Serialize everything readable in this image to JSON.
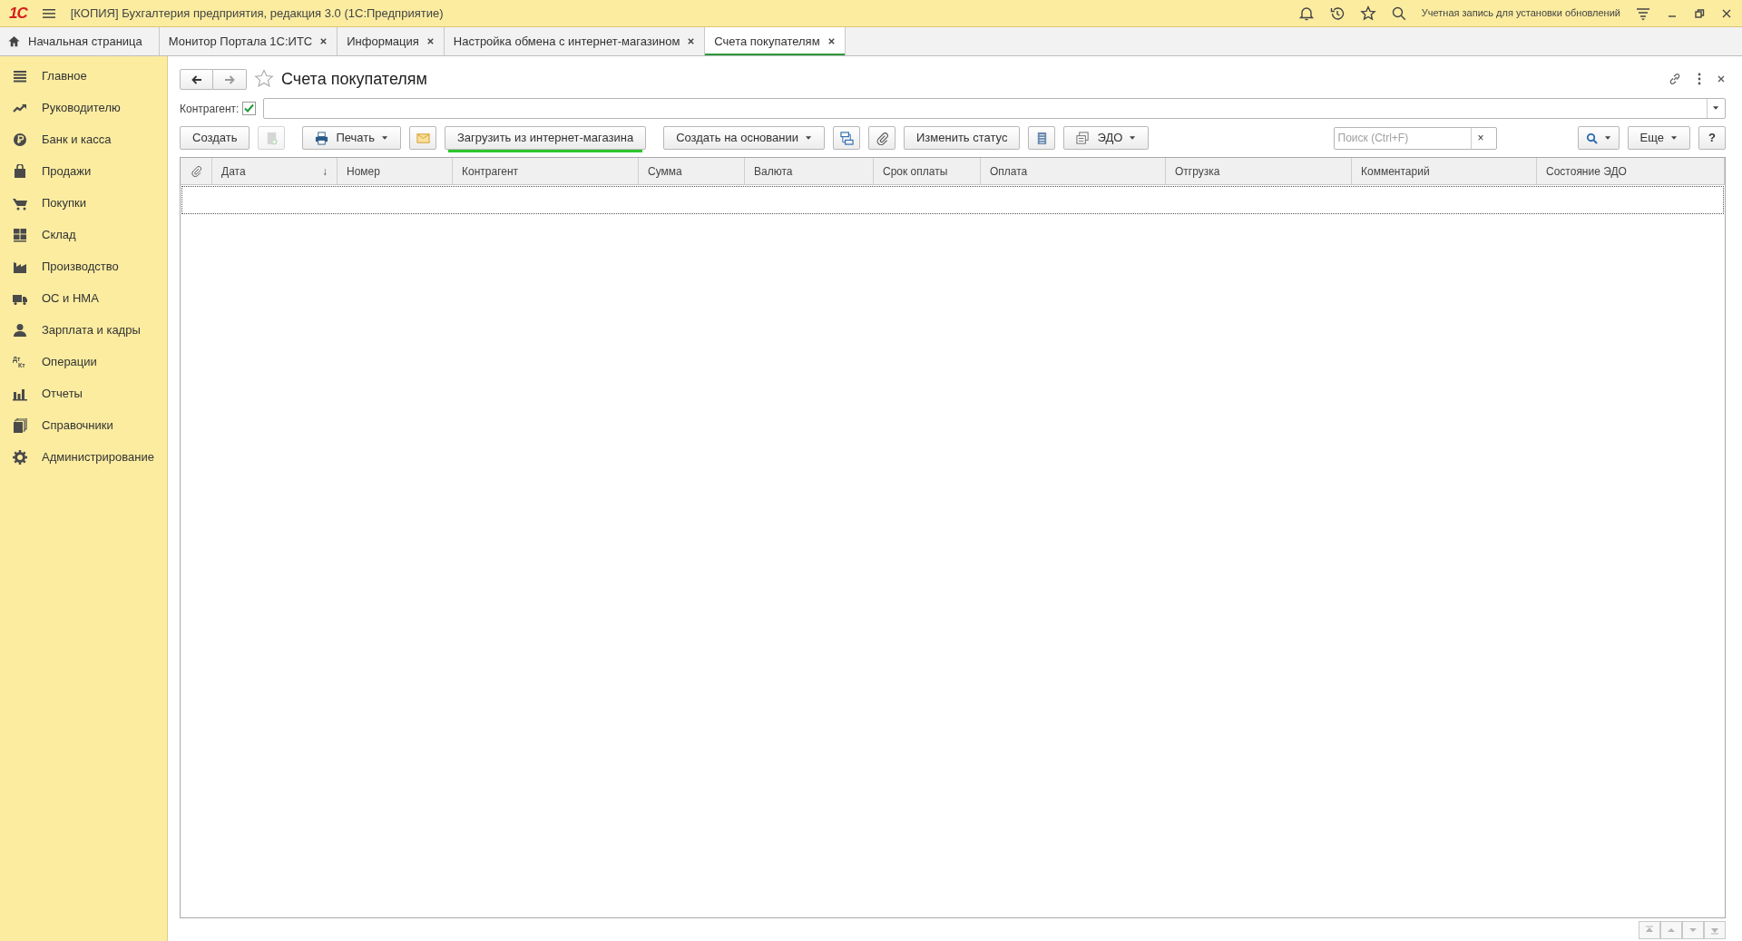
{
  "window": {
    "logo": "1С",
    "title": "[КОПИЯ] Бухгалтерия предприятия, редакция 3.0  (1С:Предприятие)",
    "account": "Учетная запись для установки обновлений"
  },
  "tabs": [
    {
      "label": "Начальная страница",
      "kind": "home",
      "selected": false
    },
    {
      "label": "Монитор Портала 1С:ИТС",
      "kind": "document",
      "selected": false
    },
    {
      "label": "Информация",
      "kind": "document",
      "selected": false
    },
    {
      "label": "Настройка обмена с интернет-магазином",
      "kind": "document",
      "selected": false
    },
    {
      "label": "Счета покупателям",
      "kind": "document",
      "selected": true
    }
  ],
  "sidebar": {
    "items": [
      {
        "label": "Главное"
      },
      {
        "label": "Руководителю"
      },
      {
        "label": "Банк и касса"
      },
      {
        "label": "Продажи"
      },
      {
        "label": "Покупки"
      },
      {
        "label": "Склад"
      },
      {
        "label": "Производство"
      },
      {
        "label": "ОС и НМА"
      },
      {
        "label": "Зарплата и кадры"
      },
      {
        "label": "Операции",
        "icon_text": [
          "Дт",
          "Кт"
        ]
      },
      {
        "label": "Отчеты"
      },
      {
        "label": "Справочники"
      },
      {
        "label": "Администрирование"
      }
    ]
  },
  "form": {
    "title": "Счета покупателям",
    "favorite": false,
    "filter": {
      "label": "Контрагент:",
      "checked": true
    },
    "toolbar": [
      {
        "kind": "text",
        "label": "Создать"
      },
      {
        "kind": "icon",
        "disabled": true
      },
      {
        "kind": "text",
        "label": "Печать",
        "dropdown": true
      },
      {
        "kind": "icon"
      },
      {
        "kind": "text",
        "label": "Загрузить из интернет-магазина",
        "highlighted": true
      },
      {
        "kind": "text",
        "label": "Создать на основании",
        "dropdown": true
      },
      {
        "kind": "icon"
      },
      {
        "kind": "icon"
      },
      {
        "kind": "text",
        "label": "Изменить статус"
      },
      {
        "kind": "icon"
      },
      {
        "kind": "text",
        "label": "ЭДО",
        "dropdown": true
      }
    ],
    "search": {
      "placeholder": "Поиск (Ctrl+F)",
      "clear": "×"
    },
    "more": "Еще",
    "help": "?",
    "table": {
      "columns": [
        {
          "kind": "icon"
        },
        {
          "kind": "text",
          "label": "Дата",
          "sort_mark": "↓"
        },
        {
          "kind": "text",
          "label": "Номер"
        },
        {
          "kind": "text",
          "label": "Контрагент"
        },
        {
          "kind": "text",
          "label": "Сумма"
        },
        {
          "kind": "text",
          "label": "Валюта"
        },
        {
          "kind": "text",
          "label": "Срок оплаты"
        },
        {
          "kind": "text",
          "label": "Оплата"
        },
        {
          "kind": "text",
          "label": "Отгрузка"
        },
        {
          "kind": "text",
          "label": "Комментарий"
        },
        {
          "kind": "text",
          "label": "Состояние ЭДО"
        }
      ]
    }
  }
}
